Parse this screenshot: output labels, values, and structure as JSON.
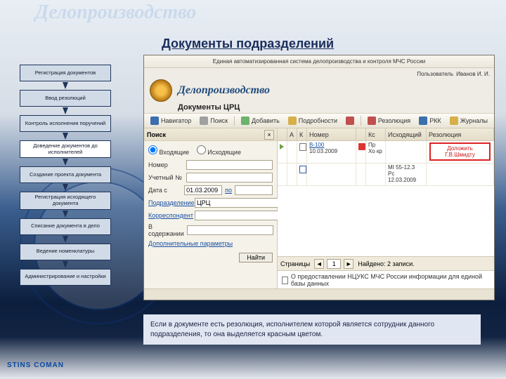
{
  "slide": {
    "title": "Делопроизводство",
    "subtitle": "Документы подразделений",
    "note": "Если в документе есть резолюция, исполнителем которой является сотрудник данного подразделения, то она выделяется красным цветом.",
    "brand": "STINS COMAN"
  },
  "nav": [
    "Регистрация документов",
    "Ввод резолюций",
    "Контроль исполнения поручений",
    "Доведение документов до исполнителей",
    "Создание проекта документа",
    "Регистрация исходящего документа",
    "Списание документа в дело",
    "Ведение номенклатуры",
    "Администрирование и настройки"
  ],
  "nav_active_index": 3,
  "app": {
    "system_caption": "Единая автоматизированная система делопроизводства и контроля МЧС России",
    "user_label": "Пользователь",
    "user_name": "Иванов И. И.",
    "title": "Делопроизводство",
    "subtitle": "Документы ЦРЦ",
    "toolbar": {
      "navigator": "Навигатор",
      "search": "Поиск",
      "add": "Добавить",
      "details": "Подробности",
      "delete_icon": "✕",
      "resolution": "Резолюция",
      "rkk": "РКК",
      "journals": "Журналы"
    },
    "search": {
      "title": "Поиск",
      "incoming": "Входящие",
      "outgoing": "Исходящие",
      "number": "Номер",
      "account_no": "Учетный №",
      "date_from": "Дата с",
      "date_from_value": "01.03.2009",
      "date_to": "по",
      "dept": "Подразделение",
      "dept_value": "ЦРЦ",
      "correspondent": "Корреспондент",
      "in_content": "В содержании",
      "extra": "Дополнительные параметры",
      "find": "Найти"
    },
    "grid": {
      "cols": [
        "",
        "А",
        "К",
        "Номер",
        "",
        "Кс",
        "Исходящий",
        "Резолюция"
      ],
      "rows": [
        {
          "num_link": "В-100",
          "num_sub": "10.03.2009",
          "ks": "Пр Хо кр",
          "out": "",
          "res_line1": "Доложить",
          "res_line2": "Г.В.Шмидту",
          "has_flags": true
        },
        {
          "num_link": "",
          "num_sub": "",
          "ks": "",
          "out_line1": "МІ 55-12.3",
          "out_line2": "Рс 12.03.2009",
          "res_line1": "",
          "res_line2": "",
          "has_flags": false
        }
      ],
      "pager_label": "Страницы",
      "pager_page": "1",
      "found_label": "Найдено: 2 записи.",
      "detail": "О предоставлении НЦУКС МЧС России информации для единой базы данных"
    }
  }
}
